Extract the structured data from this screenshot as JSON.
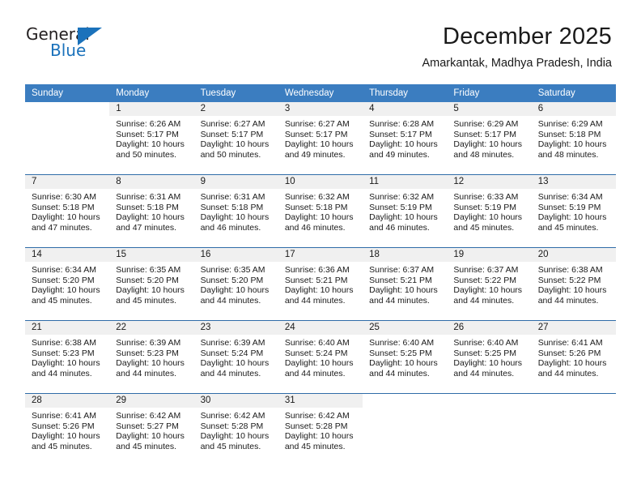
{
  "brand": {
    "name_part1": "General",
    "name_part2": "Blue",
    "accent_color": "#1b72bb"
  },
  "header": {
    "month_title": "December 2025",
    "location": "Amarkantak, Madhya Pradesh, India"
  },
  "calendar": {
    "header_bg": "#3b7dc0",
    "daynum_bg": "#f0f0f0",
    "separator_color": "#2f6ca8",
    "weekday_headers": [
      "Sunday",
      "Monday",
      "Tuesday",
      "Wednesday",
      "Thursday",
      "Friday",
      "Saturday"
    ],
    "weeks": [
      [
        {
          "day": "",
          "sunrise": "",
          "sunset": "",
          "daylight_a": "",
          "daylight_b": "",
          "blank": true
        },
        {
          "day": "1",
          "sunrise": "Sunrise: 6:26 AM",
          "sunset": "Sunset: 5:17 PM",
          "daylight_a": "Daylight: 10 hours",
          "daylight_b": "and 50 minutes."
        },
        {
          "day": "2",
          "sunrise": "Sunrise: 6:27 AM",
          "sunset": "Sunset: 5:17 PM",
          "daylight_a": "Daylight: 10 hours",
          "daylight_b": "and 50 minutes."
        },
        {
          "day": "3",
          "sunrise": "Sunrise: 6:27 AM",
          "sunset": "Sunset: 5:17 PM",
          "daylight_a": "Daylight: 10 hours",
          "daylight_b": "and 49 minutes."
        },
        {
          "day": "4",
          "sunrise": "Sunrise: 6:28 AM",
          "sunset": "Sunset: 5:17 PM",
          "daylight_a": "Daylight: 10 hours",
          "daylight_b": "and 49 minutes."
        },
        {
          "day": "5",
          "sunrise": "Sunrise: 6:29 AM",
          "sunset": "Sunset: 5:17 PM",
          "daylight_a": "Daylight: 10 hours",
          "daylight_b": "and 48 minutes."
        },
        {
          "day": "6",
          "sunrise": "Sunrise: 6:29 AM",
          "sunset": "Sunset: 5:18 PM",
          "daylight_a": "Daylight: 10 hours",
          "daylight_b": "and 48 minutes."
        }
      ],
      [
        {
          "day": "7",
          "sunrise": "Sunrise: 6:30 AM",
          "sunset": "Sunset: 5:18 PM",
          "daylight_a": "Daylight: 10 hours",
          "daylight_b": "and 47 minutes."
        },
        {
          "day": "8",
          "sunrise": "Sunrise: 6:31 AM",
          "sunset": "Sunset: 5:18 PM",
          "daylight_a": "Daylight: 10 hours",
          "daylight_b": "and 47 minutes."
        },
        {
          "day": "9",
          "sunrise": "Sunrise: 6:31 AM",
          "sunset": "Sunset: 5:18 PM",
          "daylight_a": "Daylight: 10 hours",
          "daylight_b": "and 46 minutes."
        },
        {
          "day": "10",
          "sunrise": "Sunrise: 6:32 AM",
          "sunset": "Sunset: 5:18 PM",
          "daylight_a": "Daylight: 10 hours",
          "daylight_b": "and 46 minutes."
        },
        {
          "day": "11",
          "sunrise": "Sunrise: 6:32 AM",
          "sunset": "Sunset: 5:19 PM",
          "daylight_a": "Daylight: 10 hours",
          "daylight_b": "and 46 minutes."
        },
        {
          "day": "12",
          "sunrise": "Sunrise: 6:33 AM",
          "sunset": "Sunset: 5:19 PM",
          "daylight_a": "Daylight: 10 hours",
          "daylight_b": "and 45 minutes."
        },
        {
          "day": "13",
          "sunrise": "Sunrise: 6:34 AM",
          "sunset": "Sunset: 5:19 PM",
          "daylight_a": "Daylight: 10 hours",
          "daylight_b": "and 45 minutes."
        }
      ],
      [
        {
          "day": "14",
          "sunrise": "Sunrise: 6:34 AM",
          "sunset": "Sunset: 5:20 PM",
          "daylight_a": "Daylight: 10 hours",
          "daylight_b": "and 45 minutes."
        },
        {
          "day": "15",
          "sunrise": "Sunrise: 6:35 AM",
          "sunset": "Sunset: 5:20 PM",
          "daylight_a": "Daylight: 10 hours",
          "daylight_b": "and 45 minutes."
        },
        {
          "day": "16",
          "sunrise": "Sunrise: 6:35 AM",
          "sunset": "Sunset: 5:20 PM",
          "daylight_a": "Daylight: 10 hours",
          "daylight_b": "and 44 minutes."
        },
        {
          "day": "17",
          "sunrise": "Sunrise: 6:36 AM",
          "sunset": "Sunset: 5:21 PM",
          "daylight_a": "Daylight: 10 hours",
          "daylight_b": "and 44 minutes."
        },
        {
          "day": "18",
          "sunrise": "Sunrise: 6:37 AM",
          "sunset": "Sunset: 5:21 PM",
          "daylight_a": "Daylight: 10 hours",
          "daylight_b": "and 44 minutes."
        },
        {
          "day": "19",
          "sunrise": "Sunrise: 6:37 AM",
          "sunset": "Sunset: 5:22 PM",
          "daylight_a": "Daylight: 10 hours",
          "daylight_b": "and 44 minutes."
        },
        {
          "day": "20",
          "sunrise": "Sunrise: 6:38 AM",
          "sunset": "Sunset: 5:22 PM",
          "daylight_a": "Daylight: 10 hours",
          "daylight_b": "and 44 minutes."
        }
      ],
      [
        {
          "day": "21",
          "sunrise": "Sunrise: 6:38 AM",
          "sunset": "Sunset: 5:23 PM",
          "daylight_a": "Daylight: 10 hours",
          "daylight_b": "and 44 minutes."
        },
        {
          "day": "22",
          "sunrise": "Sunrise: 6:39 AM",
          "sunset": "Sunset: 5:23 PM",
          "daylight_a": "Daylight: 10 hours",
          "daylight_b": "and 44 minutes."
        },
        {
          "day": "23",
          "sunrise": "Sunrise: 6:39 AM",
          "sunset": "Sunset: 5:24 PM",
          "daylight_a": "Daylight: 10 hours",
          "daylight_b": "and 44 minutes."
        },
        {
          "day": "24",
          "sunrise": "Sunrise: 6:40 AM",
          "sunset": "Sunset: 5:24 PM",
          "daylight_a": "Daylight: 10 hours",
          "daylight_b": "and 44 minutes."
        },
        {
          "day": "25",
          "sunrise": "Sunrise: 6:40 AM",
          "sunset": "Sunset: 5:25 PM",
          "daylight_a": "Daylight: 10 hours",
          "daylight_b": "and 44 minutes."
        },
        {
          "day": "26",
          "sunrise": "Sunrise: 6:40 AM",
          "sunset": "Sunset: 5:25 PM",
          "daylight_a": "Daylight: 10 hours",
          "daylight_b": "and 44 minutes."
        },
        {
          "day": "27",
          "sunrise": "Sunrise: 6:41 AM",
          "sunset": "Sunset: 5:26 PM",
          "daylight_a": "Daylight: 10 hours",
          "daylight_b": "and 44 minutes."
        }
      ],
      [
        {
          "day": "28",
          "sunrise": "Sunrise: 6:41 AM",
          "sunset": "Sunset: 5:26 PM",
          "daylight_a": "Daylight: 10 hours",
          "daylight_b": "and 45 minutes."
        },
        {
          "day": "29",
          "sunrise": "Sunrise: 6:42 AM",
          "sunset": "Sunset: 5:27 PM",
          "daylight_a": "Daylight: 10 hours",
          "daylight_b": "and 45 minutes."
        },
        {
          "day": "30",
          "sunrise": "Sunrise: 6:42 AM",
          "sunset": "Sunset: 5:28 PM",
          "daylight_a": "Daylight: 10 hours",
          "daylight_b": "and 45 minutes."
        },
        {
          "day": "31",
          "sunrise": "Sunrise: 6:42 AM",
          "sunset": "Sunset: 5:28 PM",
          "daylight_a": "Daylight: 10 hours",
          "daylight_b": "and 45 minutes."
        },
        {
          "day": "",
          "sunrise": "",
          "sunset": "",
          "daylight_a": "",
          "daylight_b": "",
          "blank": true
        },
        {
          "day": "",
          "sunrise": "",
          "sunset": "",
          "daylight_a": "",
          "daylight_b": "",
          "blank": true
        },
        {
          "day": "",
          "sunrise": "",
          "sunset": "",
          "daylight_a": "",
          "daylight_b": "",
          "blank": true
        }
      ]
    ]
  }
}
